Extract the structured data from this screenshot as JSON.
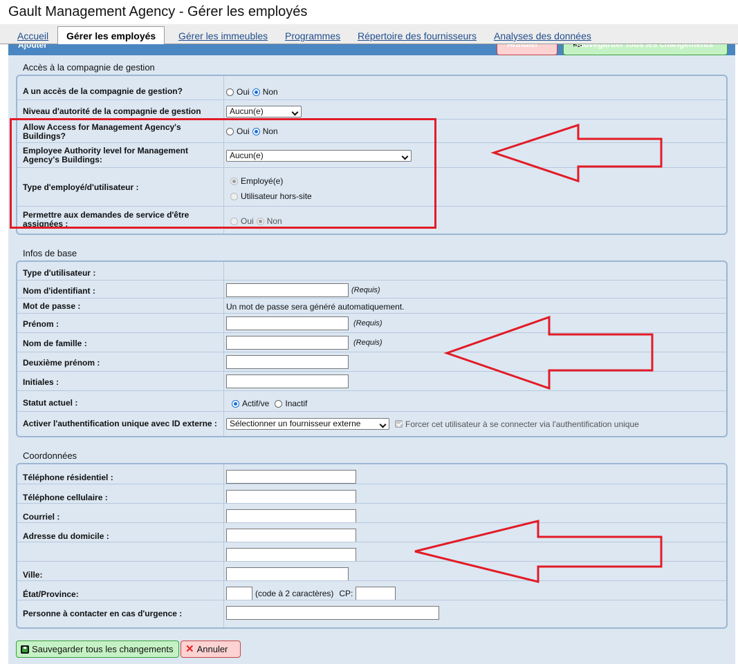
{
  "page_title": "Gault Management Agency - Gérer les employés",
  "tabs": [
    {
      "label": "Accueil"
    },
    {
      "label": "Gérer les employés"
    },
    {
      "label": "Gérer les immeubles"
    },
    {
      "label": "Programmes"
    },
    {
      "label": "Répertoire des fournisseurs"
    },
    {
      "label": "Analyses des données"
    }
  ],
  "panel": {
    "header": "Ajouter",
    "cancel_label": "Annuler",
    "save_all_label": "Sauvegarder tous les changements"
  },
  "access_section": {
    "title": "Accès à la compagnie de gestion",
    "rows": {
      "has_access": {
        "label": "A un accès de la compagnie de gestion?",
        "yes": "Oui",
        "no": "Non",
        "selected": "Non"
      },
      "authority": {
        "label": "Niveau d'autorité de la compagnie de gestion",
        "value": "Aucun(e)"
      },
      "buildings_access": {
        "label": "Allow Access for Management Agency's Buildings?",
        "yes": "Oui",
        "no": "Non",
        "selected": "Non"
      },
      "buildings_authority": {
        "label": "Employee Authority level for Management Agency's Buildings:",
        "value": "Aucun(e)"
      },
      "user_type": {
        "label": "Type d'employé/d'utilisateur :",
        "options": [
          "Employé(e)",
          "Utilisateur hors-site"
        ],
        "selected": "Employé(e)"
      },
      "service_requests": {
        "label": "Permettre aux demandes de service d'être assignées :",
        "yes": "Oui",
        "no": "Non",
        "selected": "Non"
      }
    }
  },
  "basic_section": {
    "title": "Infos de base",
    "user_type_label": "Type d'utilisateur :",
    "login_label": "Nom d'identifiant :",
    "password_label": "Mot de passe :",
    "password_value": "Un mot de passe sera généré automatiquement.",
    "firstname_label": "Prénom :",
    "lastname_label": "Nom de famille :",
    "middlename_label": "Deuxième prénom :",
    "initials_label": "Initiales :",
    "status_label": "Statut actuel :",
    "status_active": "Actif/ve",
    "status_inactive": "Inactif",
    "status_selected": "Actif/ve",
    "sso_label": "Activer l'authentification unique avec ID externe :",
    "sso_select": "Sélectionner un fournisseur externe",
    "sso_force": "Forcer cet utilisateur à se connecter via l'authentification unique",
    "required": "(Requis)"
  },
  "contact_section": {
    "title": "Coordonnées",
    "home_phone_label": "Téléphone résidentiel :",
    "cell_phone_label": "Téléphone cellulaire :",
    "email_label": "Courriel :",
    "address_label": "Adresse du domicile :",
    "city_label": "Ville:",
    "state_label": "État/Province:",
    "state_hint": "(code à 2 caractères)",
    "zip_label": "CP:",
    "emergency_label": "Personne à contacter en cas d'urgence :"
  },
  "footer": {
    "save_all_label": "Sauvegarder tous les changements",
    "cancel_label": "Annuler"
  },
  "colors": {
    "annotation": "#e21b26",
    "panel_bg": "#dce7f2",
    "panel_header": "#4a86c1",
    "save_button": "#c5f2c5",
    "cancel_button": "#fcd2d2"
  }
}
